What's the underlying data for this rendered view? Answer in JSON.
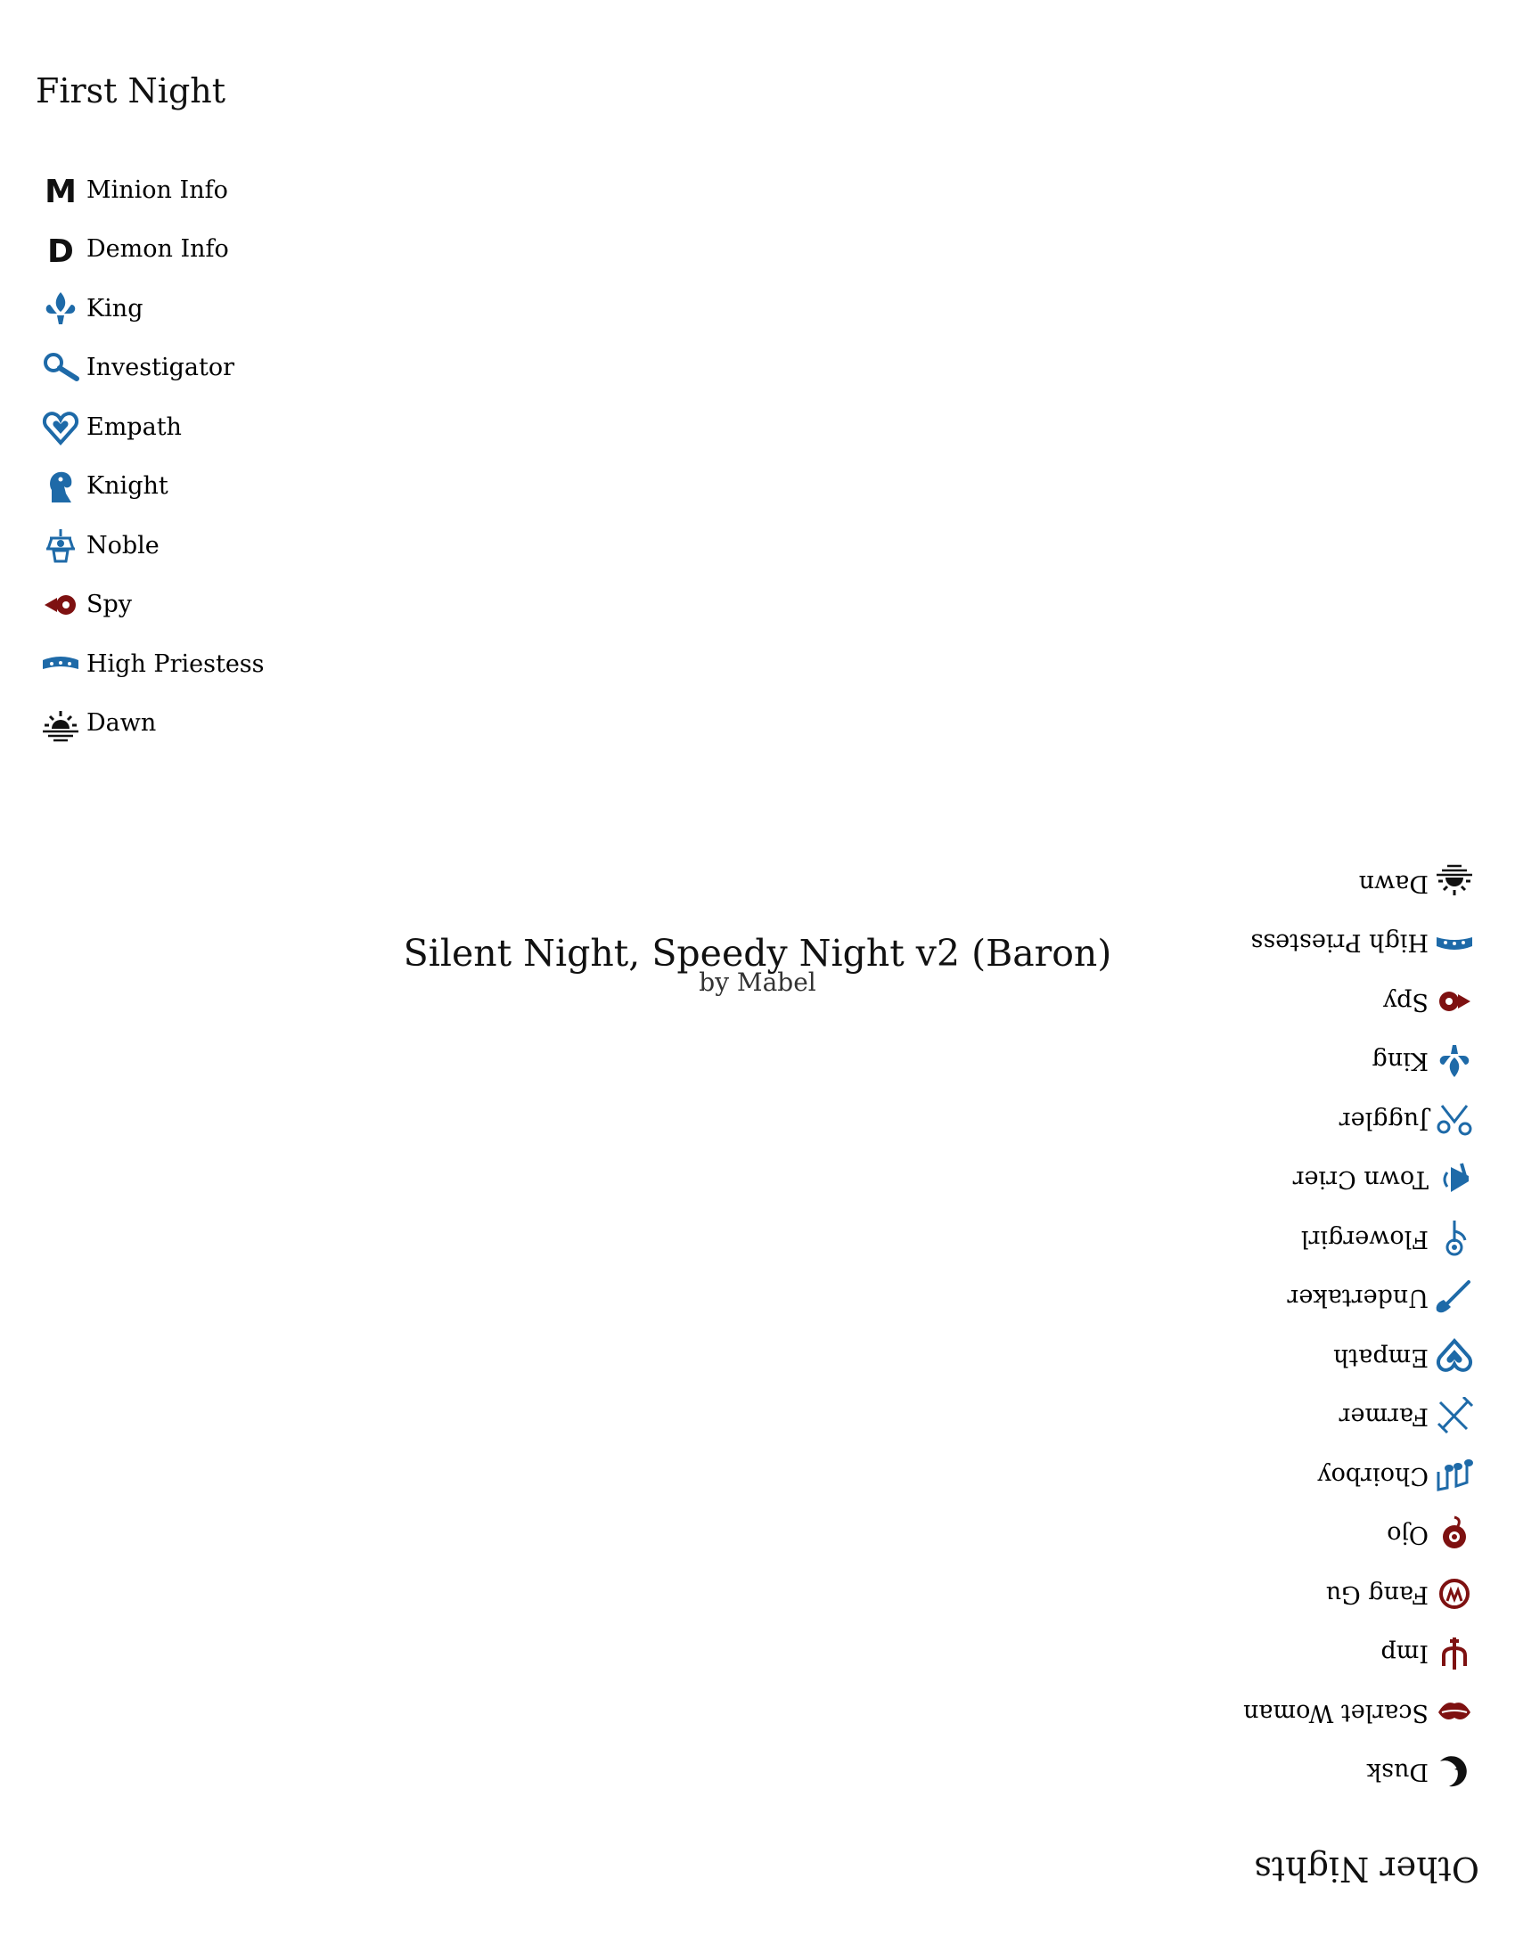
{
  "title": "Silent Night, Speedy Night v2 (Baron)",
  "author": "by Mabel",
  "colors": {
    "good": "#1e6aa8",
    "evil": "#7e1111",
    "info": "#111111"
  },
  "first_night": {
    "heading": "First Night",
    "items": [
      {
        "label": "Minion Info",
        "icon": "minion-info-icon",
        "team": "info"
      },
      {
        "label": "Demon Info",
        "icon": "demon-info-icon",
        "team": "info"
      },
      {
        "label": "King",
        "icon": "king-icon",
        "team": "good"
      },
      {
        "label": "Investigator",
        "icon": "investigator-icon",
        "team": "good"
      },
      {
        "label": "Empath",
        "icon": "empath-icon",
        "team": "good"
      },
      {
        "label": "Knight",
        "icon": "knight-icon",
        "team": "good"
      },
      {
        "label": "Noble",
        "icon": "noble-icon",
        "team": "good"
      },
      {
        "label": "Spy",
        "icon": "spy-icon",
        "team": "evil"
      },
      {
        "label": "High Priestess",
        "icon": "high-priestess-icon",
        "team": "good"
      },
      {
        "label": "Dawn",
        "icon": "dawn-icon",
        "team": "info"
      }
    ]
  },
  "other_nights": {
    "heading": "Other Nights",
    "items": [
      {
        "label": "Dusk",
        "icon": "dusk-icon",
        "team": "info"
      },
      {
        "label": "Scarlet Woman",
        "icon": "scarlet-woman-icon",
        "team": "evil"
      },
      {
        "label": "Imp",
        "icon": "imp-icon",
        "team": "evil"
      },
      {
        "label": "Fang Gu",
        "icon": "fang-gu-icon",
        "team": "evil"
      },
      {
        "label": "Ojo",
        "icon": "ojo-icon",
        "team": "evil"
      },
      {
        "label": "Choirboy",
        "icon": "choirboy-icon",
        "team": "good"
      },
      {
        "label": "Farmer",
        "icon": "farmer-icon",
        "team": "good"
      },
      {
        "label": "Empath",
        "icon": "empath-icon",
        "team": "good"
      },
      {
        "label": "Undertaker",
        "icon": "undertaker-icon",
        "team": "good"
      },
      {
        "label": "Flowergirl",
        "icon": "flowergirl-icon",
        "team": "good"
      },
      {
        "label": "Town Crier",
        "icon": "town-crier-icon",
        "team": "good"
      },
      {
        "label": "Juggler",
        "icon": "juggler-icon",
        "team": "good"
      },
      {
        "label": "King",
        "icon": "king-icon",
        "team": "good"
      },
      {
        "label": "Spy",
        "icon": "spy-icon",
        "team": "evil"
      },
      {
        "label": "High Priestess",
        "icon": "high-priestess-icon",
        "team": "good"
      },
      {
        "label": "Dawn",
        "icon": "dawn-icon",
        "team": "info"
      }
    ]
  }
}
